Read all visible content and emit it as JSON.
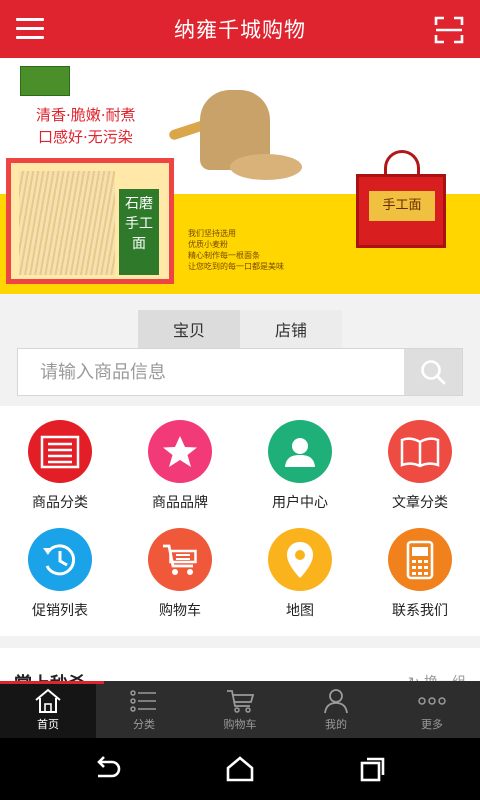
{
  "header": {
    "title": "纳雍千城购物",
    "menu_icon": "hamburger-menu-icon",
    "scan_icon": "scan-icon",
    "accent_color": "#e0242f"
  },
  "banner": {
    "slogan_line1": "清香·脆嫩·耐煮",
    "slogan_line2": "口感好·无污染",
    "package_label": "石磨手工面",
    "gift_label": "手工面",
    "copy_lines": [
      "我们坚持选用",
      "优质小麦粉",
      "精心制作每一根面条",
      "让您吃到的每一口都是美味"
    ],
    "carousel_count": 4,
    "carousel_active": 4
  },
  "search": {
    "tabs": [
      {
        "label": "宝贝",
        "active": true
      },
      {
        "label": "店铺",
        "active": false
      }
    ],
    "placeholder": "请输入商品信息",
    "value": ""
  },
  "categories": [
    {
      "label": "商品分类",
      "icon": "list-icon",
      "color": "#e31e26"
    },
    {
      "label": "商品品牌",
      "icon": "star-icon",
      "color": "#f23a78"
    },
    {
      "label": "用户中心",
      "icon": "user-icon",
      "color": "#1fb07a"
    },
    {
      "label": "文章分类",
      "icon": "book-icon",
      "color": "#ee4b43"
    },
    {
      "label": "促销列表",
      "icon": "clock-icon",
      "color": "#1aa3e8"
    },
    {
      "label": "购物车",
      "icon": "cart-icon",
      "color": "#f0583a"
    },
    {
      "label": "地图",
      "icon": "location-pin-icon",
      "color": "#fbb31d"
    },
    {
      "label": "联系我们",
      "icon": "phone-icon",
      "color": "#f0811d"
    }
  ],
  "section": {
    "title": "掌上秒杀",
    "more": "换一组"
  },
  "tabbar": [
    {
      "label": "首页",
      "icon": "home-icon",
      "active": true
    },
    {
      "label": "分类",
      "icon": "category-list-icon",
      "active": false
    },
    {
      "label": "购物车",
      "icon": "cart-icon",
      "active": false
    },
    {
      "label": "我的",
      "icon": "profile-icon",
      "active": false
    },
    {
      "label": "更多",
      "icon": "more-dots-icon",
      "active": false
    }
  ],
  "system_nav": {
    "back_icon": "back-icon",
    "home_icon": "home-outline-icon",
    "recents_icon": "recents-icon"
  }
}
